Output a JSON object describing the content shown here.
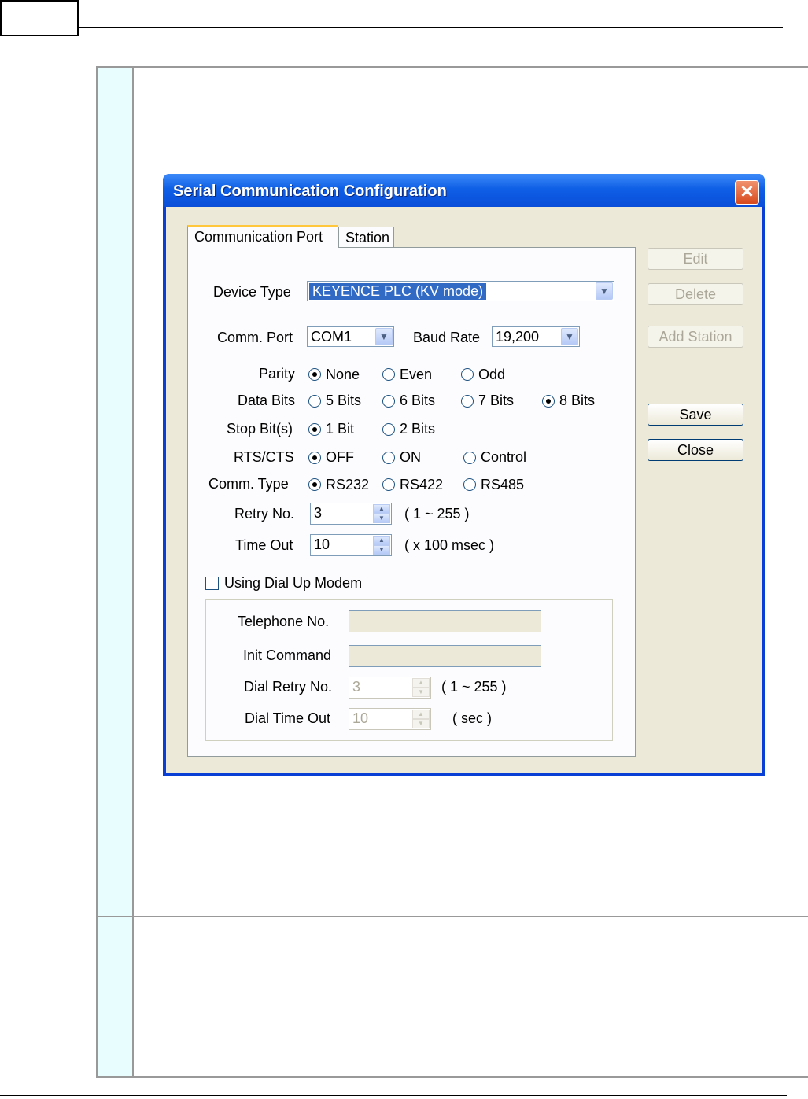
{
  "dialog": {
    "title": "Serial Communication Configuration",
    "close_glyph": "✕",
    "tabs": [
      "Communication Port",
      "Station"
    ],
    "device_type": {
      "label": "Device Type",
      "value": "KEYENCE PLC (KV mode)"
    },
    "comm_port": {
      "label": "Comm. Port",
      "value": "COM1"
    },
    "baud_rate": {
      "label": "Baud Rate",
      "value": "19,200"
    },
    "parity": {
      "label": "Parity",
      "options": [
        "None",
        "Even",
        "Odd"
      ],
      "selected": "None"
    },
    "data_bits": {
      "label": "Data Bits",
      "options": [
        "5 Bits",
        "6 Bits",
        "7 Bits",
        "8 Bits"
      ],
      "selected": "8 Bits"
    },
    "stop_bits": {
      "label": "Stop Bit(s)",
      "options": [
        "1 Bit",
        "2 Bits"
      ],
      "selected": "1 Bit"
    },
    "rts_cts": {
      "label": "RTS/CTS",
      "options": [
        "OFF",
        "ON",
        "Control"
      ],
      "selected": "OFF"
    },
    "comm_type": {
      "label": "Comm. Type",
      "options": [
        "RS232",
        "RS422",
        "RS485"
      ],
      "selected": "RS232"
    },
    "retry_no": {
      "label": "Retry No.",
      "value": "3",
      "range": "( 1 ~ 255 )"
    },
    "time_out": {
      "label": "Time Out",
      "value": "10",
      "unit": "( x 100 msec )"
    },
    "dial_up": {
      "checkbox_label": "Using Dial Up Modem",
      "checked": false,
      "telephone_label": "Telephone No.",
      "telephone_value": "",
      "init_command_label": "Init Command",
      "init_command_value": "",
      "dial_retry_label": "Dial Retry No.",
      "dial_retry_value": "3",
      "dial_retry_range": "( 1 ~ 255 )",
      "dial_timeout_label": "Dial Time Out",
      "dial_timeout_value": "10",
      "dial_timeout_unit": "( sec )"
    },
    "buttons": {
      "edit": "Edit",
      "delete": "Delete",
      "add_station": "Add Station",
      "save": "Save",
      "close": "Close"
    }
  }
}
